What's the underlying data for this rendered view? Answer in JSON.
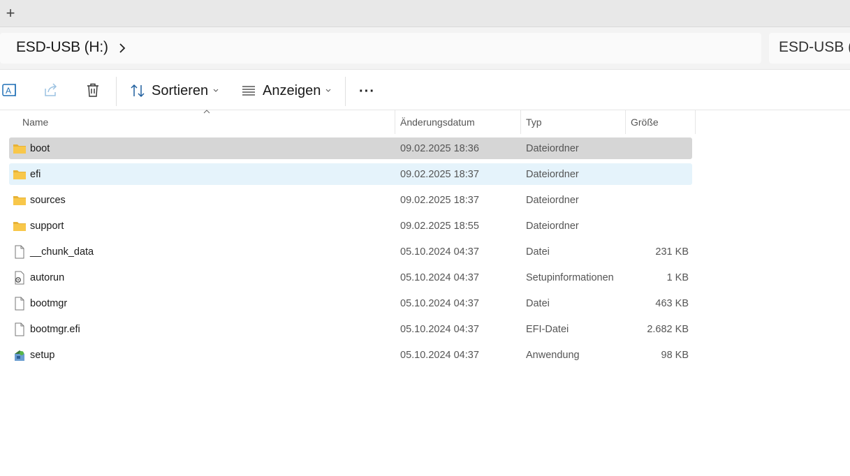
{
  "tabbar": {
    "new_tab_symbol": "+"
  },
  "address": {
    "breadcrumb": "ESD-USB (H:)"
  },
  "search": {
    "placeholder": "ESD-USB (H:) durchsuchen"
  },
  "toolbar": {
    "sort_label": "Sortieren",
    "view_label": "Anzeigen",
    "more_label": "···",
    "icons": [
      "rename-icon",
      "share-icon",
      "delete-icon",
      "sort-icon",
      "view-icon"
    ]
  },
  "columns": {
    "name": "Name",
    "date": "Änderungsdatum",
    "type": "Typ",
    "size": "Größe"
  },
  "colors": {
    "selected_row": "#d6d6d6",
    "hover_row": "#e5f3fb",
    "folder_yellow": "#f8c74a"
  },
  "files": [
    {
      "name": "boot",
      "date": "09.02.2025 18:36",
      "type": "Dateiordner",
      "size": "",
      "icon": "folder-icon",
      "state": "selected"
    },
    {
      "name": "efi",
      "date": "09.02.2025 18:37",
      "type": "Dateiordner",
      "size": "",
      "icon": "folder-icon",
      "state": "hover"
    },
    {
      "name": "sources",
      "date": "09.02.2025 18:37",
      "type": "Dateiordner",
      "size": "",
      "icon": "folder-icon",
      "state": ""
    },
    {
      "name": "support",
      "date": "09.02.2025 18:55",
      "type": "Dateiordner",
      "size": "",
      "icon": "folder-icon",
      "state": ""
    },
    {
      "name": "__chunk_data",
      "date": "05.10.2024 04:37",
      "type": "Datei",
      "size": "231 KB",
      "icon": "file-icon",
      "state": ""
    },
    {
      "name": "autorun",
      "date": "05.10.2024 04:37",
      "type": "Setupinformationen",
      "size": "1 KB",
      "icon": "settings-file-icon",
      "state": ""
    },
    {
      "name": "bootmgr",
      "date": "05.10.2024 04:37",
      "type": "Datei",
      "size": "463 KB",
      "icon": "file-icon",
      "state": ""
    },
    {
      "name": "bootmgr.efi",
      "date": "05.10.2024 04:37",
      "type": "EFI-Datei",
      "size": "2.682 KB",
      "icon": "file-icon",
      "state": ""
    },
    {
      "name": "setup",
      "date": "05.10.2024 04:37",
      "type": "Anwendung",
      "size": "98 KB",
      "icon": "setup-app-icon",
      "state": ""
    }
  ]
}
